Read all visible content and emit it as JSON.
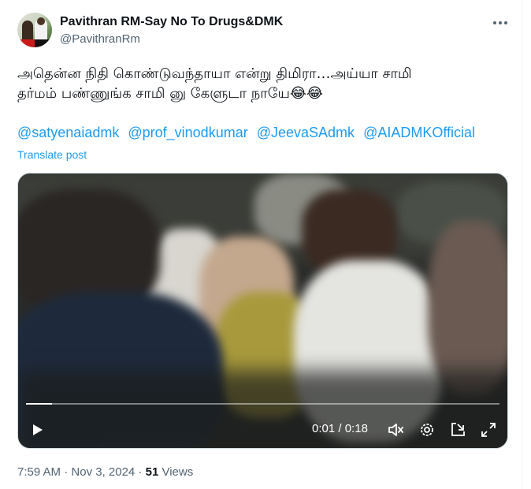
{
  "author": {
    "display_name": "Pavithran RM-Say No To Drugs&DMK",
    "handle": "@PavithranRm",
    "avatar_icon": "profile-photo"
  },
  "post": {
    "text_line1": "அதென்ன நிதி கொண்டுவந்தாயா என்று திமிரா…அய்யா சாமி",
    "text_line2": "தர்மம் பண்ணுங்க சாமி னு கேளுடா நாயே😂😂",
    "mentions": [
      "@satyenaiadmk",
      "@prof_vinodkumar",
      "@JeevaSAdmk",
      "@AIADMKOfficial"
    ],
    "translate_label": "Translate post"
  },
  "video": {
    "current_time": "0:01",
    "separator": " / ",
    "duration": "0:18",
    "progress_fraction": 0.055
  },
  "meta": {
    "time": "7:59 AM",
    "dot1": " · ",
    "date": "Nov 3, 2024",
    "dot2": " · ",
    "views_count": "51",
    "views_label": " Views"
  },
  "colors": {
    "link": "#1d9bf0",
    "secondary_text": "#536471",
    "primary_text": "#0f1419"
  }
}
